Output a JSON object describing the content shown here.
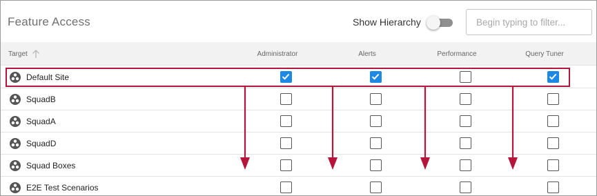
{
  "header": {
    "title": "Feature Access",
    "show_hierarchy_label": "Show Hierarchy",
    "show_hierarchy_on": false,
    "filter_placeholder": "Begin typing to filter..."
  },
  "columns": {
    "target": "Target",
    "features": [
      "Administrator",
      "Alerts",
      "Performance",
      "Query Tuner"
    ]
  },
  "rows": [
    {
      "name": "Default Site",
      "checks": [
        true,
        true,
        false,
        true
      ],
      "highlighted": true
    },
    {
      "name": "SquadB",
      "checks": [
        false,
        false,
        false,
        false
      ]
    },
    {
      "name": "SquadA",
      "checks": [
        false,
        false,
        false,
        false
      ]
    },
    {
      "name": "SquadD",
      "checks": [
        false,
        false,
        false,
        false
      ]
    },
    {
      "name": "Squad Boxes",
      "checks": [
        false,
        false,
        false,
        false
      ]
    },
    {
      "name": "E2E Test Scenarios",
      "checks": [
        false,
        false,
        false,
        false
      ]
    }
  ],
  "colors": {
    "accent": "#1e88e5",
    "annotation": "#b5143b"
  },
  "icons": {
    "row": "site-group-icon",
    "sort": "sort-ascending-arrow-icon"
  }
}
